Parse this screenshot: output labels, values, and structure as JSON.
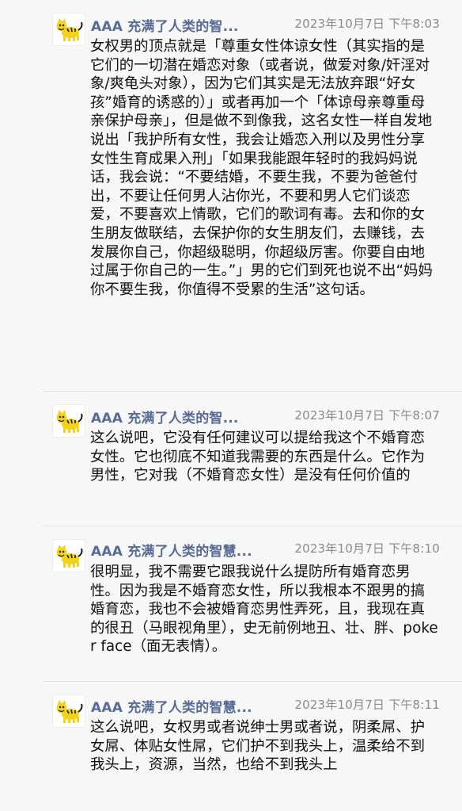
{
  "comments": [
    {
      "author": "AAA 充满了人类的智...",
      "time": "2023年10月7日 下午8:03",
      "text": "女权男的顶点就是「尊重女性体谅女性（其实指的是它们的一切潜在婚恋对象（或者说，做爱对象/奸淫对象/爽龟头对象），因为它们其实是无法放弃跟“好女孩”婚育的诱惑的）」或者再加一个「体谅母亲尊重母亲保护母亲」，但是做不到像我，这名女性一样自发地说出「我护所有女性，我会让婚恋入刑以及男性分享女性生育成果入刑」「如果我能跟年轻时的我妈妈说话，我会说：“不要结婚，不要生我，不要为爸爸付出，不要让任何男人沾你光，不要和男人它们谈恋爱，不要喜欢上情歌，它们的歌词有毒。去和你的女生朋友做联结，去保护你的女生朋友们，去赚钱，去发展你自己，你超级聪明，你超级厉害。你要自由地过属于你自己的一生。”」男的它们到死也说不出“妈妈你不要生我，你值得不受累的生活”这句话。"
    },
    {
      "author": "AAA 充满了人类的智...",
      "time": "2023年10月7日 下午8:07",
      "text": "这么说吧，它没有任何建议可以提给我这个不婚育恋女性。它也彻底不知道我需要的东西是什么。它作为男性，它对我（不婚育恋女性）是没有任何价值的"
    },
    {
      "author": "AAA 充满了人类的智慧...",
      "time": "2023年10月7日 下午8:10",
      "text": "很明显，我不需要它跟我说什么提防所有婚育恋男性。因为我是不婚育恋女性，所以我根本不跟男的搞婚育恋，我也不会被婚育恋男性弄死，且，我现在真的很丑（马眼视角里），史无前例地丑、壮、胖、poker face（面无表情）。"
    },
    {
      "author": "AAA 充满了人类的智慧...",
      "time": "2023年10月7日 下午8:11",
      "text": "这么说吧，女权男或者说绅士男或者说，阴柔屌、护女屌、体贴女性屌，它们护不到我头上，温柔给不到我头上，资源，当然，也给不到我头上"
    }
  ],
  "avatar_icon": "cartoon-tiger-icon",
  "colors": {
    "author": "#576b95",
    "time": "#8a8a8a",
    "text": "#111111",
    "background": "#f7f7f7"
  }
}
